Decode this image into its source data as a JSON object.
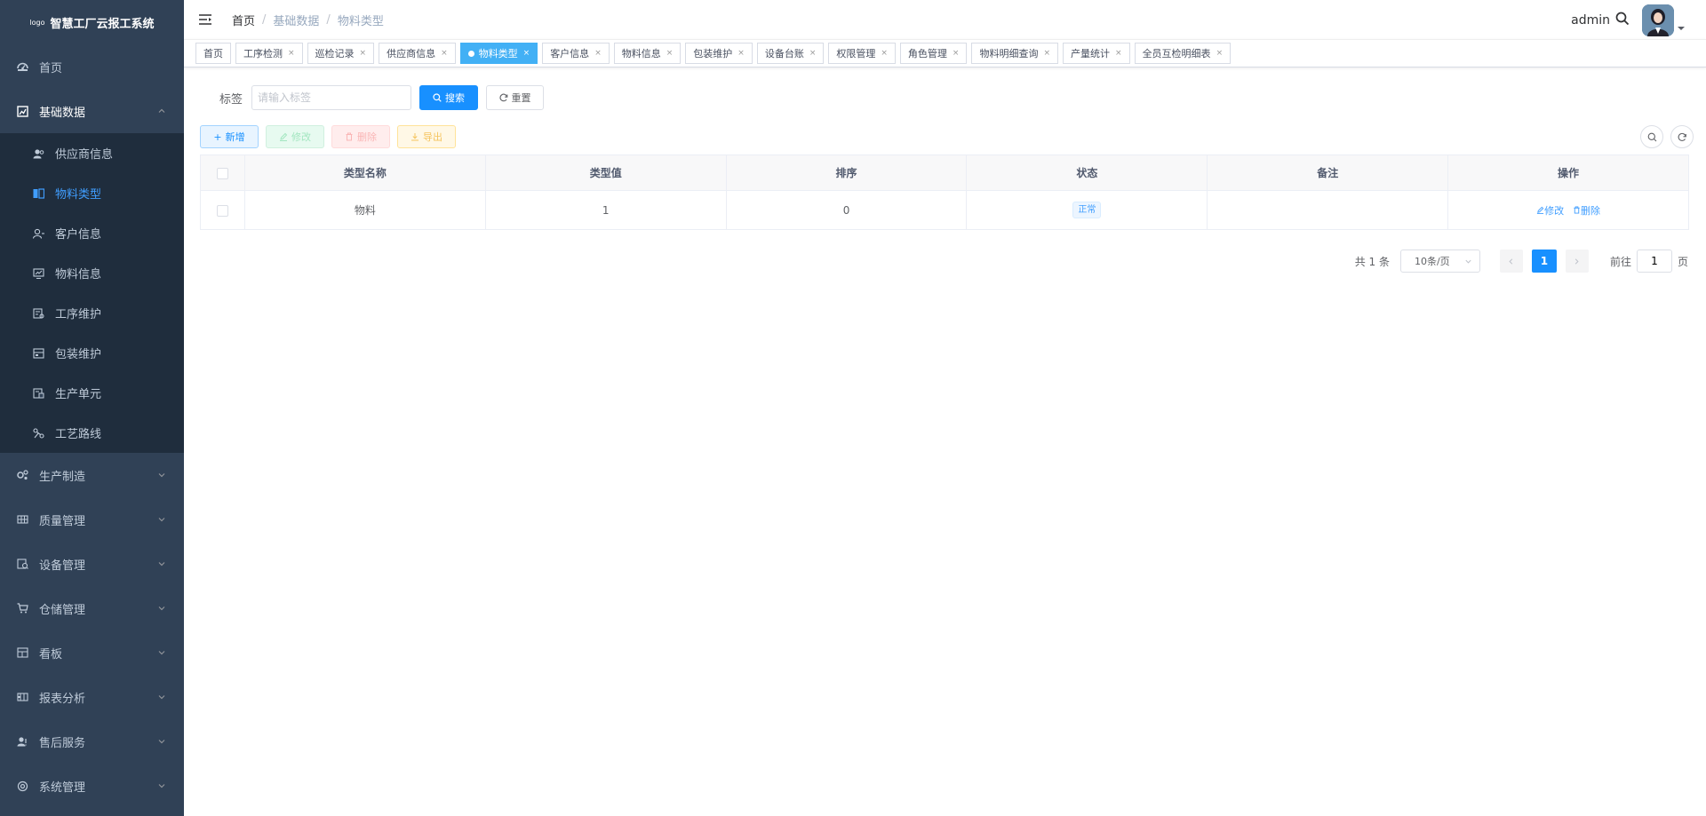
{
  "app": {
    "logo_small": "logo",
    "title": "智慧工厂云报工系统"
  },
  "sidebar": {
    "items": [
      {
        "label": "首页",
        "icon": "dashboard-icon",
        "state": "normal"
      },
      {
        "label": "基础数据",
        "icon": "basic-data-icon",
        "state": "open"
      },
      {
        "label": "生产制造",
        "icon": "production-icon",
        "state": "collapsed"
      },
      {
        "label": "质量管理",
        "icon": "quality-icon",
        "state": "collapsed"
      },
      {
        "label": "设备管理",
        "icon": "equipment-icon",
        "state": "collapsed"
      },
      {
        "label": "仓储管理",
        "icon": "warehouse-icon",
        "state": "collapsed"
      },
      {
        "label": "看板",
        "icon": "board-icon",
        "state": "collapsed"
      },
      {
        "label": "报表分析",
        "icon": "report-icon",
        "state": "collapsed"
      },
      {
        "label": "售后服务",
        "icon": "service-icon",
        "state": "collapsed"
      },
      {
        "label": "系统管理",
        "icon": "system-icon",
        "state": "collapsed"
      }
    ],
    "submenu": [
      {
        "label": "供应商信息",
        "icon": "supplier-icon"
      },
      {
        "label": "物料类型",
        "icon": "material-type-icon",
        "active": true
      },
      {
        "label": "客户信息",
        "icon": "customer-icon"
      },
      {
        "label": "物料信息",
        "icon": "material-info-icon"
      },
      {
        "label": "工序维护",
        "icon": "process-icon"
      },
      {
        "label": "包装维护",
        "icon": "package-icon"
      },
      {
        "label": "生产单元",
        "icon": "unit-icon"
      },
      {
        "label": "工艺路线",
        "icon": "route-icon"
      }
    ]
  },
  "navbar": {
    "breadcrumb": [
      "首页",
      "基础数据",
      "物料类型"
    ],
    "username": "admin"
  },
  "tags": [
    {
      "label": "首页",
      "closable": false
    },
    {
      "label": "工序检测",
      "closable": true
    },
    {
      "label": "巡检记录",
      "closable": true
    },
    {
      "label": "供应商信息",
      "closable": true
    },
    {
      "label": "物料类型",
      "closable": true,
      "active": true
    },
    {
      "label": "客户信息",
      "closable": true
    },
    {
      "label": "物料信息",
      "closable": true
    },
    {
      "label": "包装维护",
      "closable": true
    },
    {
      "label": "设备台账",
      "closable": true
    },
    {
      "label": "权限管理",
      "closable": true
    },
    {
      "label": "角色管理",
      "closable": true
    },
    {
      "label": "物料明细查询",
      "closable": true
    },
    {
      "label": "产量统计",
      "closable": true
    },
    {
      "label": "全员互检明细表",
      "closable": true
    }
  ],
  "search": {
    "label": "标签",
    "placeholder": "请输入标签",
    "search_btn": "搜索",
    "reset_btn": "重置"
  },
  "toolbar": {
    "add": "新增",
    "edit": "修改",
    "delete": "删除",
    "export": "导出"
  },
  "table": {
    "columns": [
      "类型名称",
      "类型值",
      "排序",
      "状态",
      "备注",
      "操作"
    ],
    "rows": [
      {
        "name": "物料",
        "value": "1",
        "sort": "0",
        "status": "正常",
        "remark": "",
        "op_edit": "修改",
        "op_delete": "删除"
      }
    ]
  },
  "pagination": {
    "total": "共 1 条",
    "page_size": "10条/页",
    "current": "1",
    "goto_prefix": "前往",
    "goto_value": "1",
    "goto_suffix": "页"
  },
  "colors": {
    "sidebar_bg": "#304156",
    "submenu_bg": "#1f2d3d",
    "primary": "#1890ff",
    "active_tag": "#42b0f5"
  }
}
